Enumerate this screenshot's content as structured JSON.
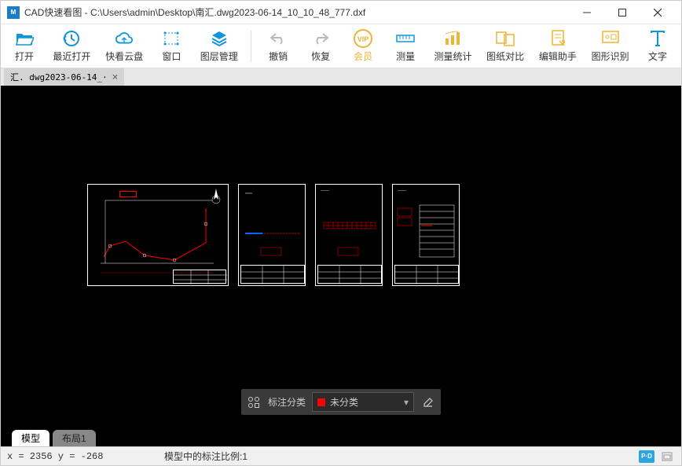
{
  "window": {
    "title": "CAD快速看图 - C:\\Users\\admin\\Desktop\\南汇.dwg2023-06-14_10_10_48_777.dxf",
    "icon_text": "M"
  },
  "toolbar": [
    {
      "label": "打开",
      "icon": "open",
      "color": "#1296db"
    },
    {
      "label": "最近打开",
      "icon": "recent",
      "color": "#1296db"
    },
    {
      "label": "快看云盘",
      "icon": "cloud",
      "color": "#1296db"
    },
    {
      "label": "窗口",
      "icon": "window",
      "color": "#1296db"
    },
    {
      "label": "图层管理",
      "icon": "layers",
      "color": "#1296db"
    },
    {
      "sep": true
    },
    {
      "label": "撤销",
      "icon": "undo",
      "color": "#bbb"
    },
    {
      "label": "恢复",
      "icon": "redo",
      "color": "#bbb"
    },
    {
      "label": "会员",
      "icon": "vip",
      "color": "#efb336"
    },
    {
      "label": "测量",
      "icon": "measure",
      "color": "#1296db"
    },
    {
      "label": "测量统计",
      "icon": "stats",
      "color": "#efb336"
    },
    {
      "label": "图纸对比",
      "icon": "compare",
      "color": "#efb336"
    },
    {
      "label": "编辑助手",
      "icon": "assist",
      "color": "#efb336"
    },
    {
      "label": "图形识别",
      "icon": "recognize",
      "color": "#efb336"
    },
    {
      "label": "文字",
      "icon": "text",
      "color": "#1296db"
    }
  ],
  "file_tab": {
    "label": "汇. dwg2023-06-14_·"
  },
  "floating_bar": {
    "label": "标注分类",
    "selected": "未分类"
  },
  "bottom_tabs": [
    {
      "label": "模型",
      "active": true
    },
    {
      "label": "布局1",
      "active": false
    }
  ],
  "status": {
    "coords": "x = 2356 y = -268",
    "center": "模型中的标注比例:1"
  }
}
